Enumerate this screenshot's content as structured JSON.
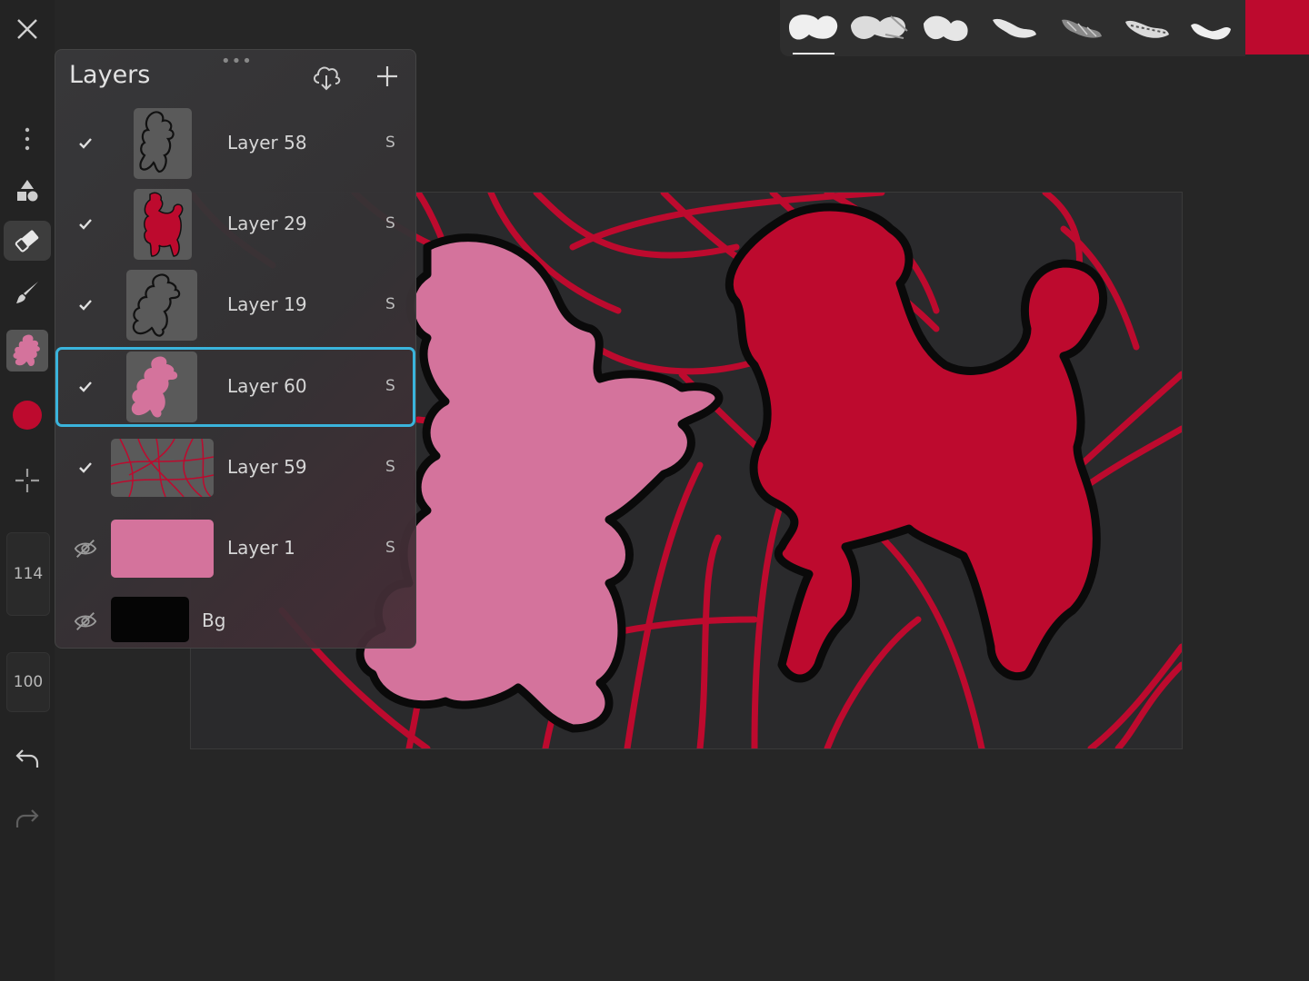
{
  "toolbar": {
    "tools": [
      "close-icon",
      "more-icon",
      "shapes-icon",
      "eraser-icon",
      "brush-icon",
      "layer-thumb-icon",
      "color-icon",
      "transform-icon",
      "undo-icon",
      "redo-icon"
    ],
    "brush_size": "114",
    "opacity": "100",
    "active_tool": "eraser",
    "current_color": "#bd0a2e"
  },
  "brushbar": {
    "brushes": [
      "brush-1",
      "brush-2",
      "brush-3",
      "brush-4",
      "brush-5",
      "brush-6",
      "brush-7"
    ],
    "selected_brush": 1,
    "color": "#bd0a2e"
  },
  "layers_panel": {
    "title": "Layers",
    "grip": "•••",
    "layers": [
      {
        "name": "Layer 58",
        "visible": true,
        "flag": "S"
      },
      {
        "name": "Layer 29",
        "visible": true,
        "flag": "S"
      },
      {
        "name": "Layer 19",
        "visible": true,
        "flag": "S"
      },
      {
        "name": "Layer 60",
        "visible": true,
        "flag": "S",
        "selected": true
      },
      {
        "name": "Layer 59",
        "visible": true,
        "flag": "S"
      },
      {
        "name": "Layer 1",
        "visible": false,
        "flag": "S"
      },
      {
        "name": "Bg",
        "visible": false,
        "flag": ""
      }
    ]
  },
  "colors": {
    "crimson": "#bd0a2e",
    "pink": "#d4739c",
    "selection": "#3ab4dc"
  }
}
